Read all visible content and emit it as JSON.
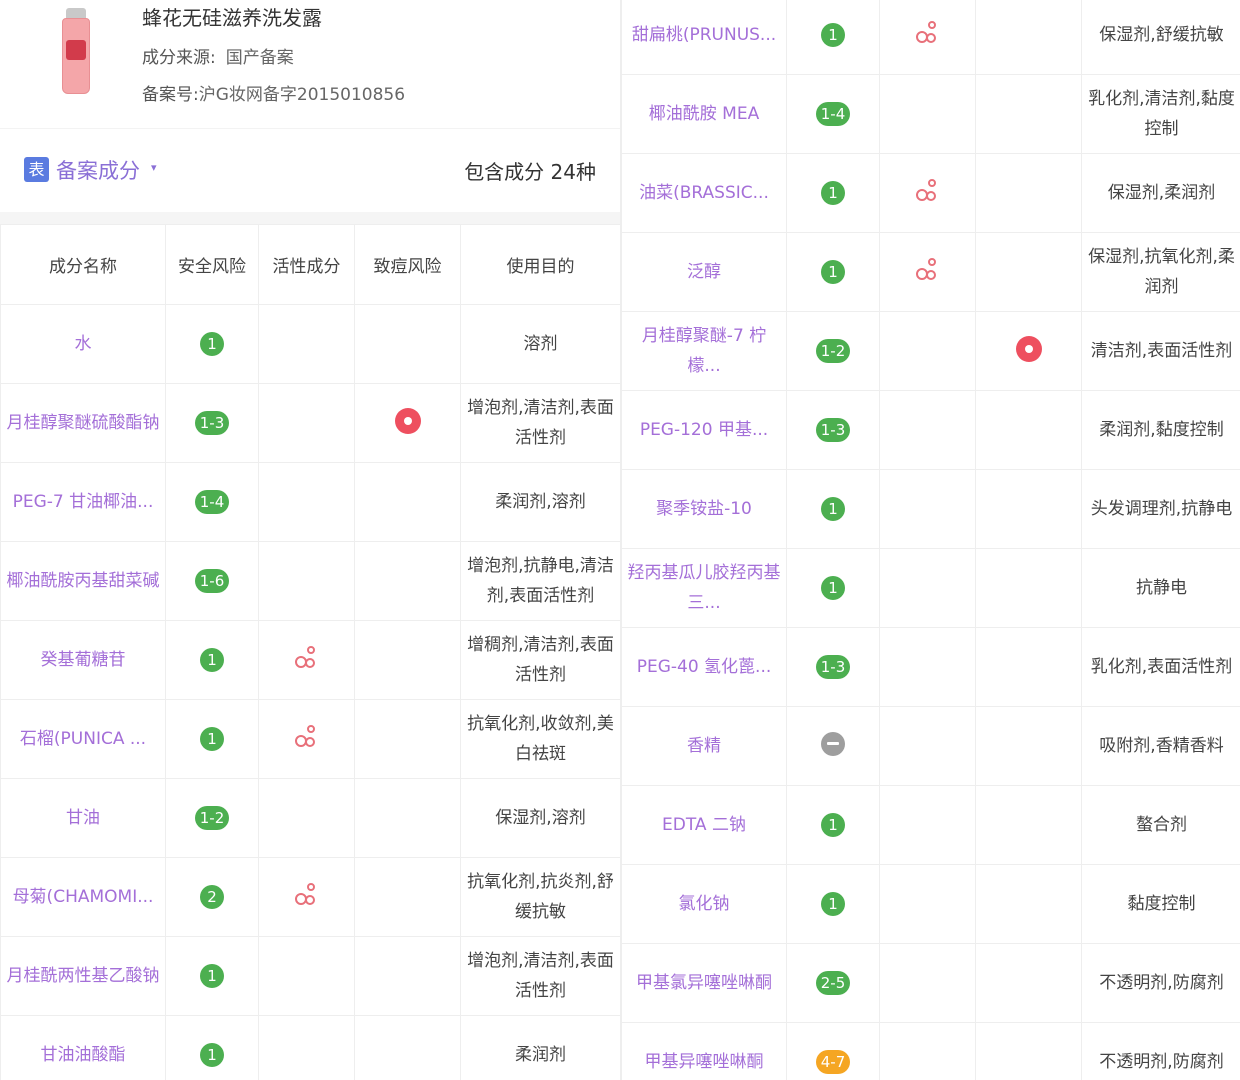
{
  "product": {
    "name": "蜂花无硅滋养洗发露",
    "source_label": "成分来源:",
    "source_value": "国产备案",
    "reg_label": "备案号:",
    "reg_value": "沪G妆网备字2015010856"
  },
  "section": {
    "icon_text": "表",
    "title": "备案成分",
    "caret": "▾",
    "count": "包含成分 24种"
  },
  "headers": [
    "成分名称",
    "安全风险",
    "活性成分",
    "致痘风险",
    "使用目的"
  ],
  "colors": {
    "name": "#a46fd8",
    "badge_green": "#4caf50",
    "badge_orange": "#f5a623",
    "badge_gray": "#9e9e9e",
    "acne": "#ee4f5f"
  },
  "left_rows": [
    {
      "name": "水",
      "risk": "1",
      "risk_color": "green",
      "active": false,
      "acne": false,
      "purpose": "溶剂"
    },
    {
      "name": "月桂醇聚醚硫酸酯钠",
      "risk": "1-3",
      "risk_color": "green",
      "active": false,
      "acne": true,
      "purpose": "增泡剂,清洁剂,表面活性剂"
    },
    {
      "name": "PEG-7 甘油椰油...",
      "risk": "1-4",
      "risk_color": "green",
      "active": false,
      "acne": false,
      "purpose": "柔润剂,溶剂"
    },
    {
      "name": "椰油酰胺丙基甜菜碱",
      "risk": "1-6",
      "risk_color": "green",
      "active": false,
      "acne": false,
      "purpose": "增泡剂,抗静电,清洁剂,表面活性剂"
    },
    {
      "name": "癸基葡糖苷",
      "risk": "1",
      "risk_color": "green",
      "active": true,
      "acne": false,
      "purpose": "增稠剂,清洁剂,表面活性剂"
    },
    {
      "name": "石榴(PUNICA ...",
      "risk": "1",
      "risk_color": "green",
      "active": true,
      "acne": false,
      "purpose": "抗氧化剂,收敛剂,美白祛斑"
    },
    {
      "name": "甘油",
      "risk": "1-2",
      "risk_color": "green",
      "active": false,
      "acne": false,
      "purpose": "保湿剂,溶剂"
    },
    {
      "name": "母菊(CHAMOMI...",
      "risk": "2",
      "risk_color": "green",
      "active": true,
      "acne": false,
      "purpose": "抗氧化剂,抗炎剂,舒缓抗敏"
    },
    {
      "name": "月桂酰两性基乙酸钠",
      "risk": "1",
      "risk_color": "green",
      "active": false,
      "acne": false,
      "purpose": "增泡剂,清洁剂,表面活性剂"
    },
    {
      "name": "甘油油酸酯",
      "risk": "1",
      "risk_color": "green",
      "active": false,
      "acne": false,
      "purpose": "柔润剂"
    }
  ],
  "right_rows": [
    {
      "name": "甜扁桃(PRUNUS...",
      "risk": "1",
      "risk_color": "green",
      "active": true,
      "acne": false,
      "purpose": "保湿剂,舒缓抗敏"
    },
    {
      "name": "椰油酰胺 MEA",
      "risk": "1-4",
      "risk_color": "green",
      "active": false,
      "acne": false,
      "purpose": "乳化剂,清洁剂,黏度控制"
    },
    {
      "name": "油菜(BRASSIC...",
      "risk": "1",
      "risk_color": "green",
      "active": true,
      "acne": false,
      "purpose": "保湿剂,柔润剂"
    },
    {
      "name": "泛醇",
      "risk": "1",
      "risk_color": "green",
      "active": true,
      "acne": false,
      "purpose": "保湿剂,抗氧化剂,柔润剂"
    },
    {
      "name": "月桂醇聚醚-7 柠檬...",
      "risk": "1-2",
      "risk_color": "green",
      "active": false,
      "acne": true,
      "purpose": "清洁剂,表面活性剂"
    },
    {
      "name": "PEG-120 甲基...",
      "risk": "1-3",
      "risk_color": "green",
      "active": false,
      "acne": false,
      "purpose": "柔润剂,黏度控制"
    },
    {
      "name": "聚季铵盐-10",
      "risk": "1",
      "risk_color": "green",
      "active": false,
      "acne": false,
      "purpose": "头发调理剂,抗静电"
    },
    {
      "name": "羟丙基瓜儿胶羟丙基三...",
      "risk": "1",
      "risk_color": "green",
      "active": false,
      "acne": false,
      "purpose": "抗静电"
    },
    {
      "name": "PEG-40 氢化蓖...",
      "risk": "1-3",
      "risk_color": "green",
      "active": false,
      "acne": false,
      "purpose": "乳化剂,表面活性剂"
    },
    {
      "name": "香精",
      "risk": "",
      "risk_color": "gray",
      "active": false,
      "acne": false,
      "purpose": "吸附剂,香精香料"
    },
    {
      "name": "EDTA 二钠",
      "risk": "1",
      "risk_color": "green",
      "active": false,
      "acne": false,
      "purpose": "螯合剂"
    },
    {
      "name": "氯化钠",
      "risk": "1",
      "risk_color": "green",
      "active": false,
      "acne": false,
      "purpose": "黏度控制"
    },
    {
      "name": "甲基氯异噻唑啉酮",
      "risk": "2-5",
      "risk_color": "green",
      "active": false,
      "acne": false,
      "purpose": "不透明剂,防腐剂"
    },
    {
      "name": "甲基异噻唑啉酮",
      "risk": "4-7",
      "risk_color": "orange",
      "active": false,
      "acne": false,
      "purpose": "不透明剂,防腐剂"
    }
  ]
}
